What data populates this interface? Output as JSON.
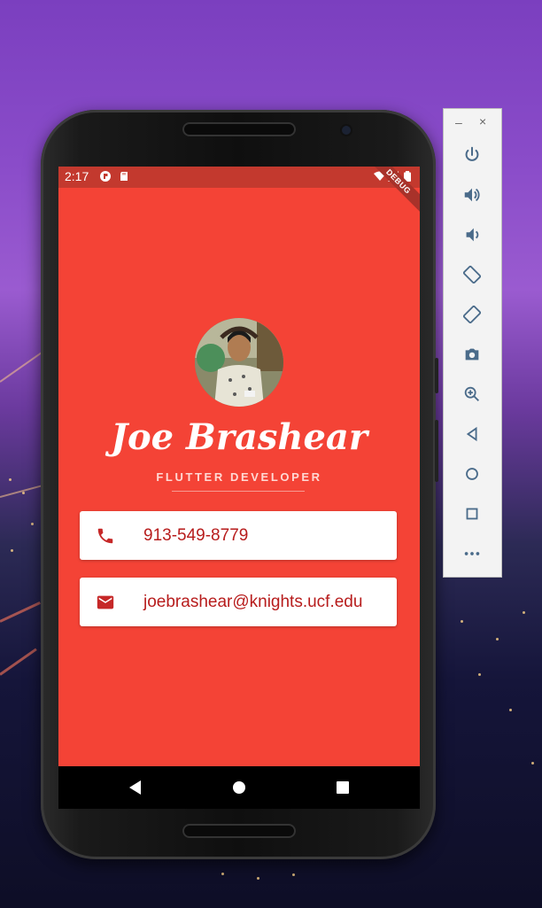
{
  "status_bar": {
    "time": "2:17",
    "debug_banner": "DEBUG"
  },
  "profile": {
    "name": "Joe Brashear",
    "title": "FLUTTER DEVELOPER",
    "phone": "913-549-8779",
    "email": "joebrashear@knights.ucf.edu"
  },
  "colors": {
    "background": "#f44336",
    "status_bar": "#c3392e",
    "card_text": "#b71c1c",
    "subtitle": "#ffd9d4"
  },
  "emulator_toolbar": {
    "window_controls": [
      "minimize-icon",
      "close-icon"
    ],
    "buttons": [
      "power-icon",
      "volume-up-icon",
      "volume-down-icon",
      "rotate-left-icon",
      "rotate-right-icon",
      "camera-icon",
      "zoom-icon",
      "back-icon",
      "home-icon",
      "overview-icon",
      "more-icon"
    ]
  },
  "navigation_bar": {
    "buttons": [
      "back-icon",
      "home-icon",
      "recents-icon"
    ]
  }
}
